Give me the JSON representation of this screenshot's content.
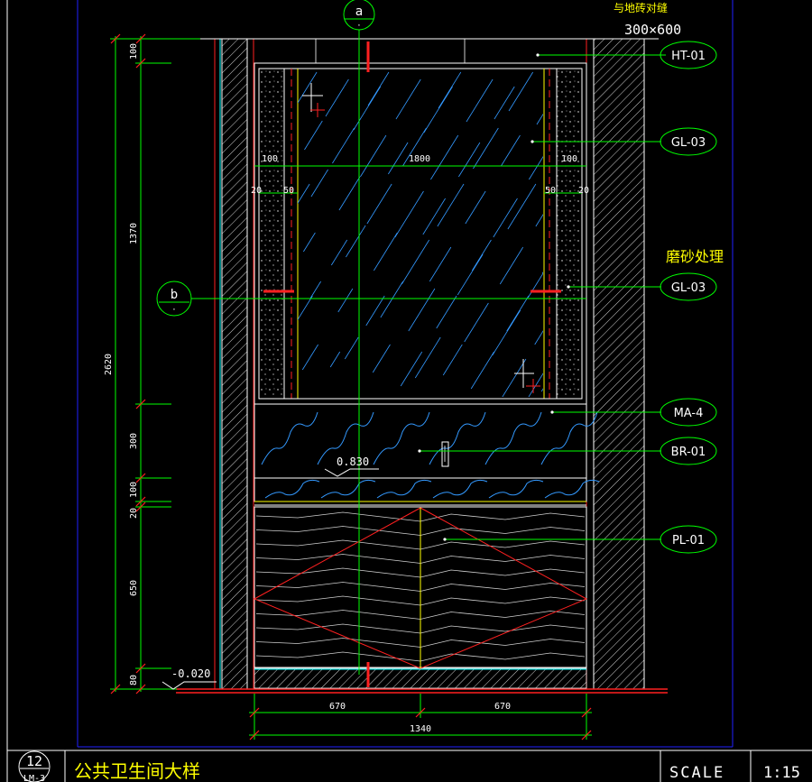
{
  "title_block": {
    "sheet_number": "12",
    "sheet_ref": "LM-3",
    "title": "公共卫生间大样",
    "scale_label": "SCALE",
    "scale_value": "1:15"
  },
  "notes": {
    "top_note": "与地砖对缝",
    "tile_size": "300×600",
    "frosted_note": "磨砂处理"
  },
  "section_markers": {
    "a": "a",
    "b": "b"
  },
  "tags": {
    "ht01": "HT-01",
    "gl03_a": "GL-03",
    "gl03_b": "GL-03",
    "ma4": "MA-4",
    "br01": "BR-01",
    "pl01": "PL-01"
  },
  "dims_vertical": {
    "d100_top": "100",
    "d1370": "1370",
    "d2620": "2620",
    "d300": "300",
    "d100_mid": "100",
    "d20": "20",
    "d650": "650",
    "d80": "80"
  },
  "dims_mirror": {
    "left_100": "100",
    "center_1800": "1800",
    "right_100": "100",
    "left_20": "20",
    "left_50": "50",
    "right_50": "50",
    "right_20": "20"
  },
  "dims_bottom": {
    "left_670": "670",
    "right_670": "670",
    "total_1340": "1340"
  },
  "levels": {
    "counter": "0.830",
    "floor": "-0.020"
  },
  "colors": {
    "background": "#000000",
    "dimension": "#00ff00",
    "wall": "#ffffff",
    "red": "#ff2020",
    "frame": "#2020ff",
    "text": "#ffff00",
    "marble": "#3399ff",
    "cyan": "#00ffff"
  }
}
